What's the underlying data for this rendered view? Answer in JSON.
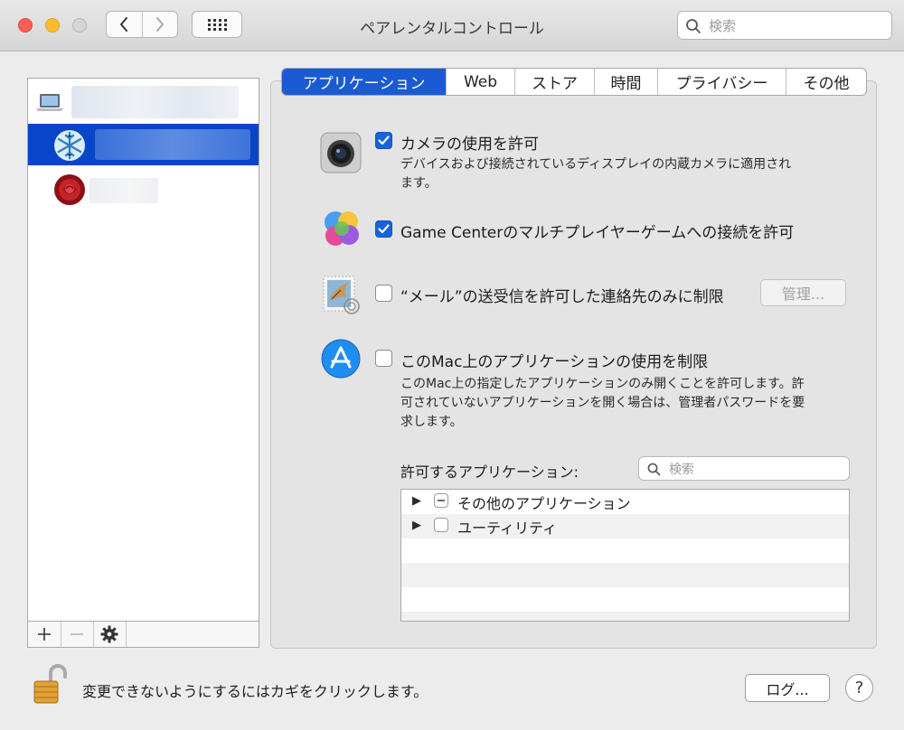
{
  "window": {
    "title": "ペアレンタルコントロール",
    "search_placeholder": "検索"
  },
  "tabs": [
    {
      "label": "アプリケーション",
      "active": true
    },
    {
      "label": "Web",
      "active": false
    },
    {
      "label": "ストア",
      "active": false
    },
    {
      "label": "時間",
      "active": false
    },
    {
      "label": "プライバシー",
      "active": false
    },
    {
      "label": "その他",
      "active": false
    }
  ],
  "users": [
    {
      "icon": "laptop-icon",
      "selected": false
    },
    {
      "icon": "snowflake-avatar-icon",
      "selected": true
    },
    {
      "icon": "rose-avatar-icon",
      "selected": false
    }
  ],
  "options": {
    "camera": {
      "label": "カメラの使用を許可",
      "checked": true,
      "desc_line1": "デバイスおよび接続されているディスプレイの内蔵カメラに適用され",
      "desc_line2": "ます。"
    },
    "gamecenter": {
      "label": "Game Centerのマルチプレイヤーゲームへの接続を許可",
      "checked": true
    },
    "mail": {
      "label": "“メール”の送受信を許可した連絡先のみに制限",
      "checked": false,
      "manage_button": "管理..."
    },
    "apps": {
      "label": "このMac上のアプリケーションの使用を制限",
      "checked": false,
      "desc_line1": "このMac上の指定したアプリケーションのみ開くことを許可します。許",
      "desc_line2": "可されていないアプリケーションを開く場合は、管理者パスワードを要",
      "desc_line3": "求します。"
    }
  },
  "allowed_apps": {
    "label": "許可するアプリケーション:",
    "search_placeholder": "検索",
    "items": [
      {
        "label": "その他のアプリケーション",
        "state": "mixed"
      },
      {
        "label": "ユーティリティ",
        "state": "unchecked"
      }
    ]
  },
  "footer": {
    "lock_message": "変更できないようにするにはカギをクリックします。",
    "log_button": "ログ...",
    "help_button": "?"
  },
  "colors": {
    "accent": "#1a5bd3",
    "selection": "#0845c8",
    "window_bg": "#ececec"
  }
}
